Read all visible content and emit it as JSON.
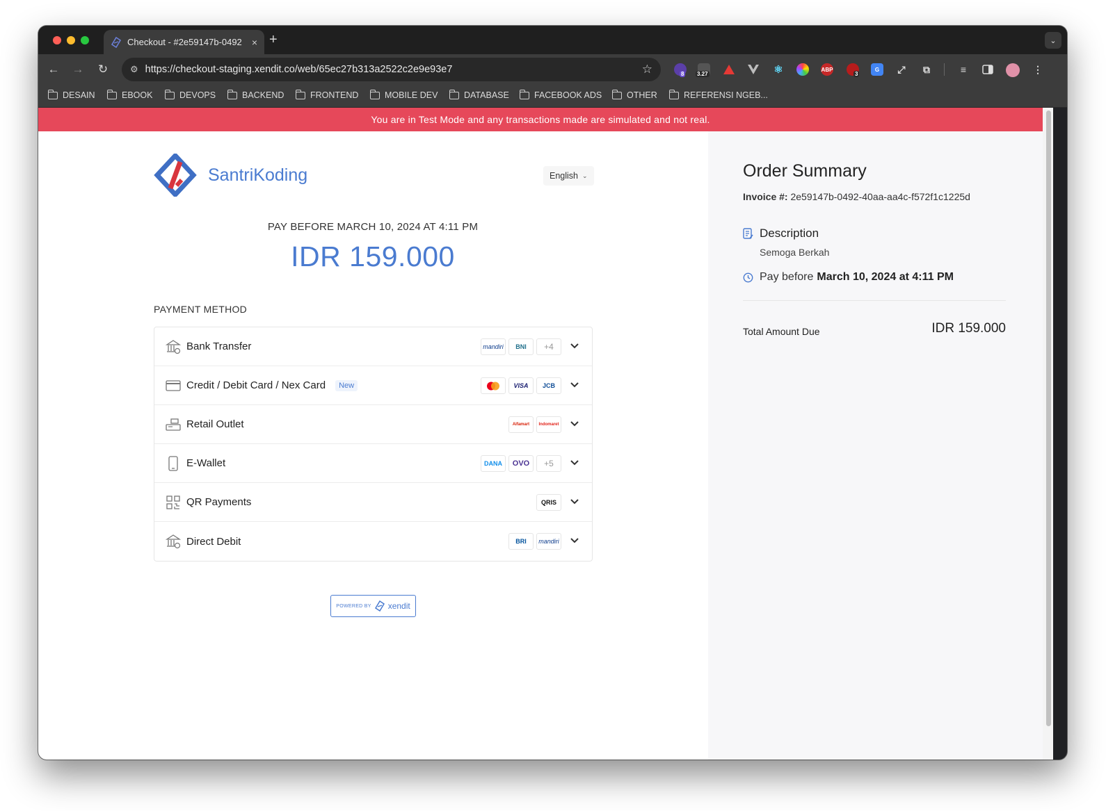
{
  "browser": {
    "tab_title": "Checkout - #2e59147b-0492",
    "tab_close": "×",
    "new_tab": "+",
    "url": "https://checkout-staging.xendit.co/web/65ec27b313a2522c2e9e93e7",
    "extension_badges": {
      "ext1": "8",
      "ext2": "3.27",
      "ext3": "3"
    },
    "bookmarks": [
      "DESAIN",
      "EBOOK",
      "DEVOPS",
      "BACKEND",
      "FRONTEND",
      "MOBILE DEV",
      "DATABASE",
      "FACEBOOK ADS",
      "OTHER",
      "REFERENSI NGEB..."
    ],
    "icons": {
      "back": "arrow-left-icon",
      "forward": "arrow-right-icon",
      "reload": "reload-icon",
      "star": "star-icon"
    }
  },
  "banner": {
    "text": "You are in Test Mode and any transactions made are simulated and not real."
  },
  "merchant": {
    "name": "SantriKoding"
  },
  "language": {
    "selected": "English"
  },
  "payment": {
    "pay_before": "PAY BEFORE MARCH 10, 2024 AT 4:11 PM",
    "amount": "IDR 159.000",
    "method_label": "PAYMENT METHOD",
    "methods": [
      {
        "name": "Bank Transfer",
        "logos": [
          "mandiri",
          "BNI"
        ],
        "more": "+4"
      },
      {
        "name": "Credit / Debit Card / Nex Card",
        "new_badge": "New",
        "logos": [
          "mastercard",
          "VISA",
          "JCB"
        ]
      },
      {
        "name": "Retail Outlet",
        "logos": [
          "Alfamart",
          "Indomaret"
        ]
      },
      {
        "name": "E-Wallet",
        "logos": [
          "DANA",
          "OVO"
        ],
        "more": "+5"
      },
      {
        "name": "QR Payments",
        "logos": [
          "QRIS"
        ]
      },
      {
        "name": "Direct Debit",
        "logos": [
          "BRI",
          "mandiri"
        ]
      }
    ],
    "powered_by": "POWERED BY",
    "powered_brand": "xendit"
  },
  "summary": {
    "title": "Order Summary",
    "invoice_label": "Invoice #:",
    "invoice_value": "2e59147b-0492-40aa-aa4c-f572f1c1225d",
    "description_label": "Description",
    "description_value": "Semoga Berkah",
    "pay_before_prefix": "Pay before",
    "pay_before_value": "March 10, 2024 at 4:11 PM",
    "total_label": "Total Amount Due",
    "total_value": "IDR 159.000"
  },
  "colors": {
    "accent": "#4a7bd0",
    "banner": "#e6485a",
    "brand_red": "#d9363e"
  }
}
